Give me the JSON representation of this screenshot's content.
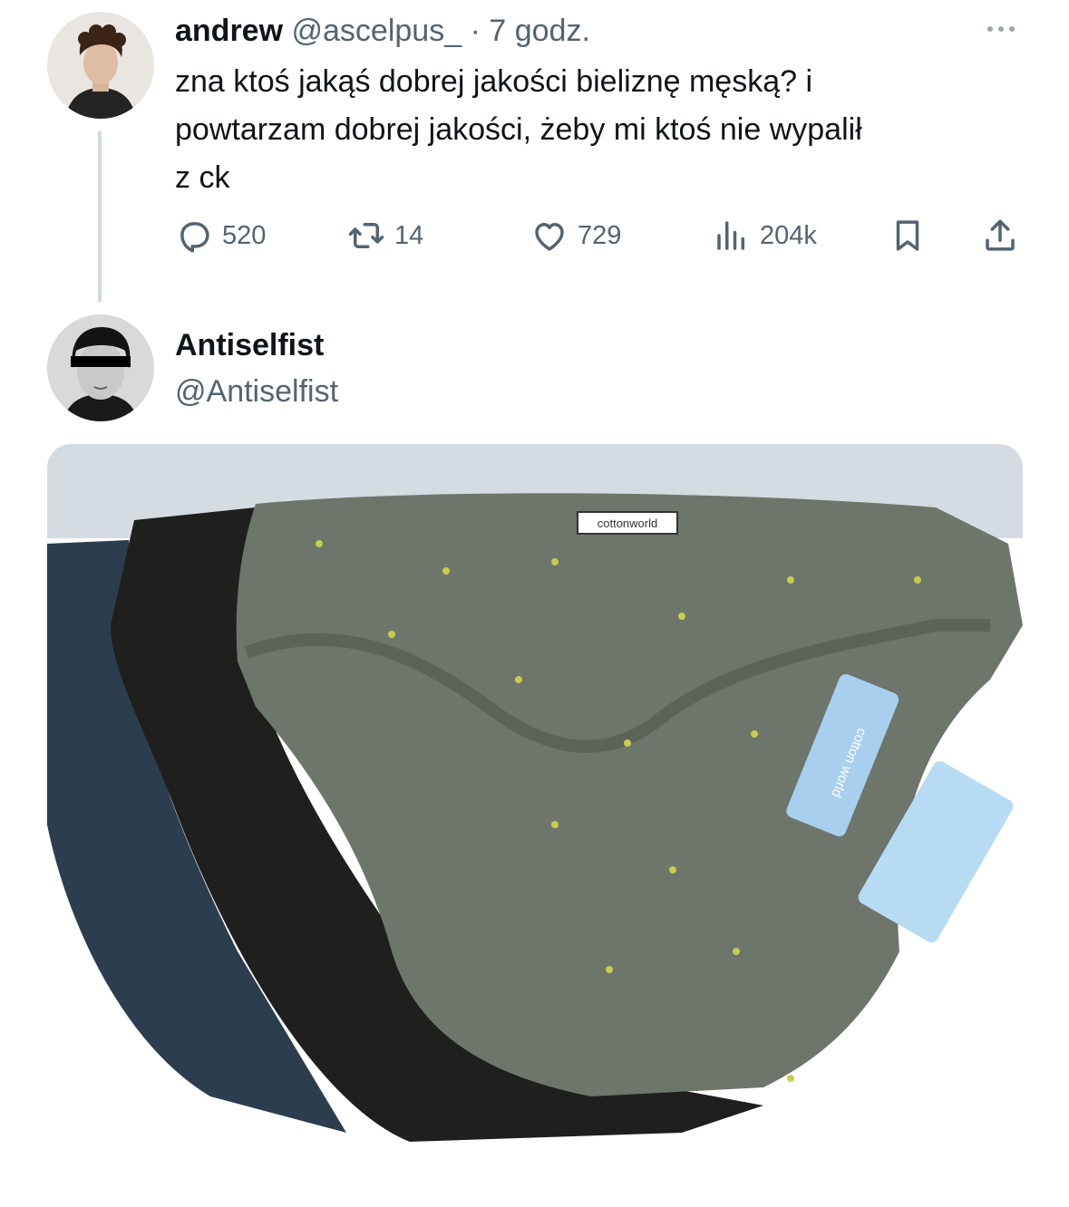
{
  "tweet1": {
    "author_name": "andrew",
    "author_handle": "@ascelpus_",
    "separator": "·",
    "time": "7 godz.",
    "text_lines": [
      "zna ktoś jakąś dobrej jakości bieliznę męską? i",
      "powtarzam dobrej jakości, żeby mi ktoś nie wypalił",
      "z ck"
    ],
    "metrics": {
      "replies": "520",
      "retweets": "14",
      "likes": "729",
      "views": "204k"
    }
  },
  "tweet2": {
    "author_name": "Antiselfist",
    "author_handle": "@Antiselfist",
    "image": {
      "label_text": "cottonworld",
      "tag_text": "cotton world"
    }
  },
  "colors": {
    "text_primary": "#0f1419",
    "text_secondary": "#536471",
    "thread_line": "#cfd9de",
    "image_bg": "#d4dbe1",
    "brief_navy": "#2c3e4e",
    "brief_black": "#1f201d",
    "brief_olive": "#6e756a",
    "tag_blue": "#a8cfee"
  },
  "icons": [
    "more-icon",
    "reply-icon",
    "retweet-icon",
    "like-icon",
    "views-icon",
    "bookmark-icon",
    "share-icon"
  ]
}
